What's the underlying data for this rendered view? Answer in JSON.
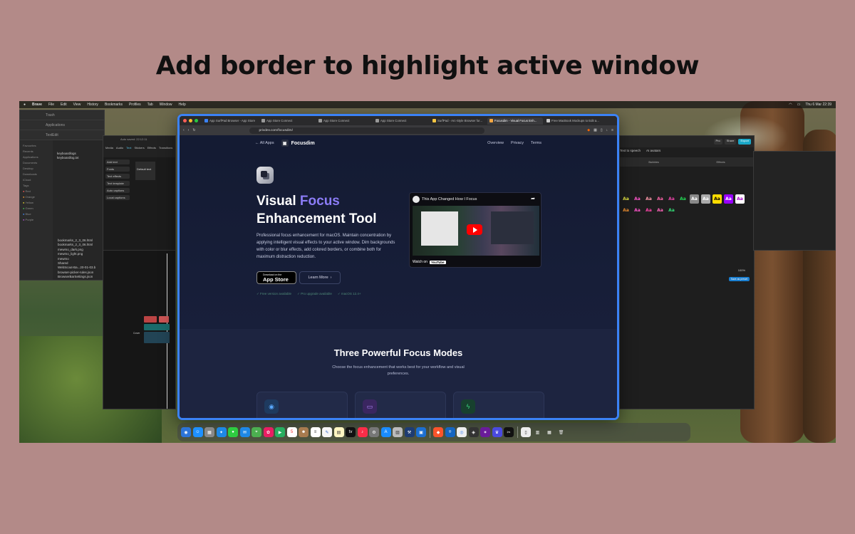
{
  "headline": "Add border to highlight active window",
  "menubar": {
    "app": "Brave",
    "items": [
      "File",
      "Edit",
      "View",
      "History",
      "Bookmarks",
      "Profiles",
      "Tab",
      "Window",
      "Help"
    ],
    "clock": "Thu 6 Mar 22:39"
  },
  "finder": {
    "title1": "Trash",
    "title2": "Applications",
    "title3": "TextEdit",
    "favourites_label": "Favourites",
    "sidebar": [
      "Recents",
      "Applications",
      "Documents",
      "Desktop",
      "Downloads"
    ],
    "icloud_label": "iCloud",
    "tags_label": "Tags",
    "tags": [
      "Red",
      "Orange",
      "Yellow",
      "Green",
      "Blue",
      "Purple"
    ],
    "files_top": [
      "keyboardlogs",
      "keyboardlog.txt"
    ],
    "files_bottom": [
      "bookmarks_2_3_06.html",
      "bookmarks_2_3_06.html",
      "mewmo_dark.png",
      "mewmo_light.png",
      "mewmo",
      "Shared",
      "WebScout-Ba...20-01-03.b",
      "browser-picker-rules.json",
      "BrowserBarSettings.json"
    ]
  },
  "capcut": {
    "title": "Auto saved: 22:12:11",
    "tools": [
      "Media",
      "Audio",
      "Text",
      "Stickers",
      "Effects",
      "Transitions"
    ],
    "menu": [
      "Add text",
      "Fonts",
      "Text effects",
      "Text template",
      "Auto captions",
      "Local captions"
    ],
    "preset": "Default text",
    "cover": "Cover"
  },
  "editor": {
    "ai_label": "Text to speech",
    "ai_avatar": "AI avatars",
    "tabs": [
      "Bubbles",
      "Effects"
    ],
    "pro_label": "Pro",
    "share_label": "Share",
    "export_label": "Export",
    "zoom": "100%",
    "save_preset": "Save as preset",
    "aa": "Aa"
  },
  "browser": {
    "tabs": [
      {
        "label": "App SurfPad Browser - App Store",
        "active": false
      },
      {
        "label": "App Store Connect",
        "active": false
      },
      {
        "label": "App Store Connect",
        "active": false
      },
      {
        "label": "App Store Connect",
        "active": false
      },
      {
        "label": "SurfPad - Arc-Style Browser for...",
        "active": false
      },
      {
        "label": "Focusdim - Visual Focus Enh...",
        "active": true
      },
      {
        "label": "Free MacBook Mockups to Edit a...",
        "active": false
      }
    ],
    "url": "privdev.com/focusdim/"
  },
  "site": {
    "back": "All Apps",
    "brand": "Focusdim",
    "nav": [
      "Overview",
      "Privacy",
      "Terms"
    ],
    "hero_title_1": "Visual",
    "hero_title_accent": "Focus",
    "hero_title_2": "Enhancement Tool",
    "description": "Professional focus enhancement for macOS. Maintain concentration by applying intelligent visual effects to your active window. Dim backgrounds with color or blur effects, add colored borders, or combine both for maximum distraction reduction.",
    "appstore_small": "Download on the",
    "appstore_big": "App Store",
    "learn_more": "Learn More",
    "checks": [
      "Free version available",
      "Pro upgrade available",
      "macOS 12.4+"
    ],
    "video_title": "This App Changed How I Focus",
    "watch_on": "Watch on",
    "youtube": "YouTube",
    "modes_title": "Three Powerful Focus Modes",
    "modes_sub": "Choose the focus enhancement that works best for your workflow and visual preferences."
  },
  "colors": {
    "accent_border": "#3b82f6",
    "accent_text": "#8b7cf6"
  }
}
